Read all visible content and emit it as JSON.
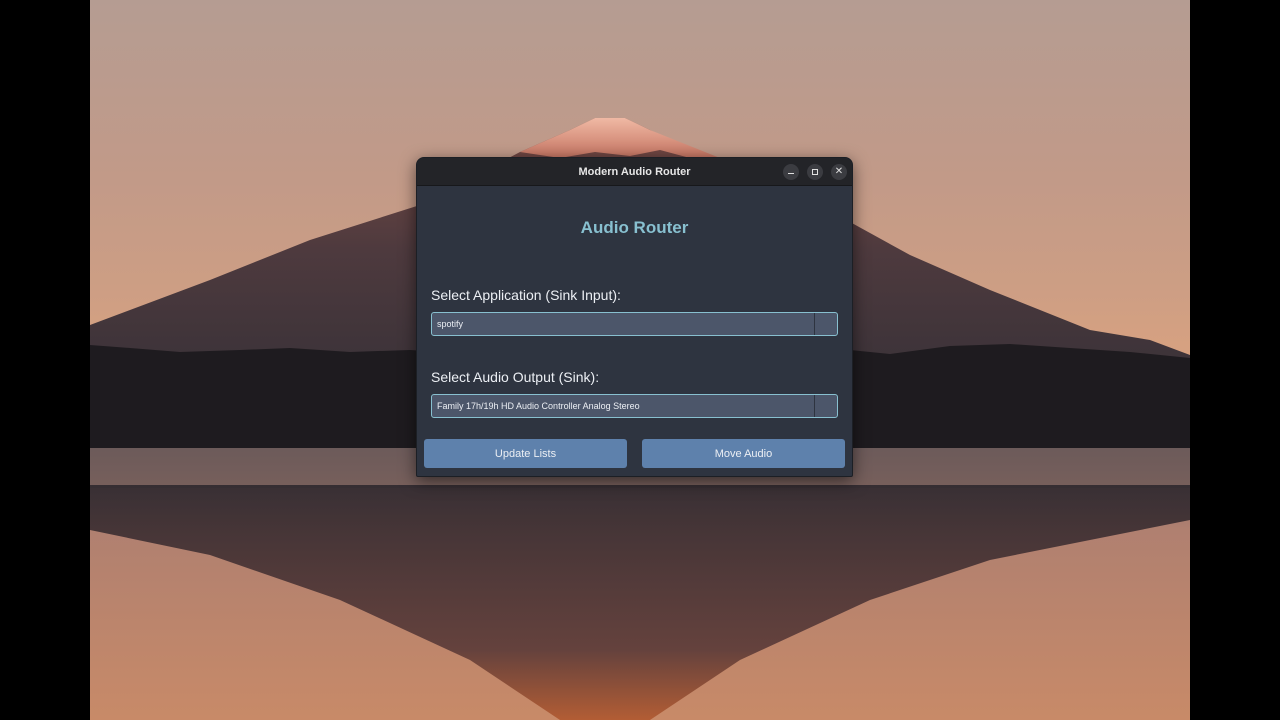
{
  "window": {
    "title": "Modern Audio Router",
    "controls": {
      "minimize": "minimize",
      "maximize": "maximize",
      "close": "✕"
    }
  },
  "app": {
    "heading": "Audio Router",
    "application_label": "Select Application (Sink Input):",
    "application_value": "spotify",
    "output_label": "Select Audio Output (Sink):",
    "output_value": "Family 17h/19h HD Audio Controller Analog Stereo",
    "update_button": "Update Lists",
    "move_button": "Move Audio"
  },
  "colors": {
    "window_bg": "#2e3440",
    "heading": "#88c0d0",
    "combo_bg": "#4c566a",
    "button_bg": "#5e81ac",
    "titlebar_bg": "#232428"
  }
}
